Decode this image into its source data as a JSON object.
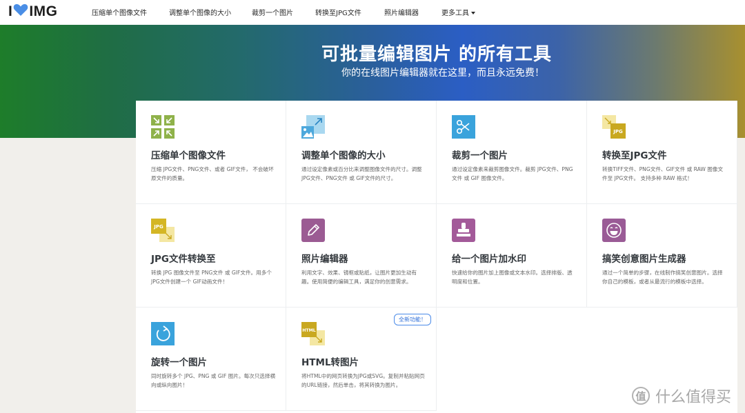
{
  "logo": {
    "text_left": "I",
    "text_right": "IMG"
  },
  "nav": {
    "items": [
      "压缩单个图像文件",
      "调整单个图像的大小",
      "裁剪一个图片",
      "转换至JPG文件",
      "照片编辑器"
    ],
    "more": "更多工具"
  },
  "hero": {
    "title": "可批量编辑图片 的所有工具",
    "subtitle": "你的在线图片编辑器就在这里，而且永远免费！"
  },
  "tools": [
    {
      "title": "压缩单个图像文件",
      "desc": "压缩 JPG文件、PNG文件、或者 GIF文件， 不会破坏原文件的质量。",
      "icon": "compress-icon",
      "color": "#8fb24a"
    },
    {
      "title": "调整单个图像的大小",
      "desc": "通过设定像素或百分比来调整图像文件的尺寸。调整 JPG文件、PNG文件 或 GIF文件的尺寸。",
      "icon": "resize-icon",
      "color": "#5fb6e0"
    },
    {
      "title": "裁剪一个图片",
      "desc": "通过设定像素来裁剪图像文件。裁剪 JPG文件、PNG文件 或 GIF 图像文件。",
      "icon": "scissors-icon",
      "color": "#3aa3dc"
    },
    {
      "title": "转换至JPG文件",
      "desc": "转换TIFF文件、PNG文件、GIF文件 或 RAW 图像文件至 JPG文件。 支持多种 RAW 格式！",
      "icon": "convert-to-jpg-icon",
      "color": "#c9b225"
    },
    {
      "title": "JPG文件转换至",
      "desc": "转换 JPG 图像文件至 PNG文件 或 GIF文件。用多个JPG文件创建一个 GIF动画文件！",
      "icon": "convert-from-jpg-icon",
      "color": "#d4b624"
    },
    {
      "title": "照片编辑器",
      "desc": "利用文字、效果、镜框或贴纸，让图片更加生动有趣。使用简便的编辑工具，满足你的创意需求。",
      "icon": "pencil-icon",
      "color": "#9b5b93"
    },
    {
      "title": "给一个图片加水印",
      "desc": "快速给你的图片加上图像或文本水印。选择排版、透明度和位置。",
      "icon": "stamp-icon",
      "color": "#a35a99"
    },
    {
      "title": "搞笑创意图片生成器",
      "desc": "通过一个简单的步骤，在线制作搞笑创意图片。选择你自己的模板，或者从最流行的模板中选择。",
      "icon": "laugh-icon",
      "color": "#9a5b96"
    },
    {
      "title": "旋转一个图片",
      "desc": "同时旋转多个 JPG、PNG 或 GIF 图片。每次只选择横向或纵向图片！",
      "icon": "rotate-icon",
      "color": "#3aa3dc"
    },
    {
      "title": "HTML转图片",
      "desc": "将HTML中的网页转换为JPG或SVG。复制并粘贴网页的URL链接，然后单击，将其转换为图片。",
      "icon": "html-icon",
      "color": "#c9a820",
      "badge": "全新功能！"
    }
  ],
  "watermark": {
    "text": "什么值得买",
    "glyph": "值"
  }
}
